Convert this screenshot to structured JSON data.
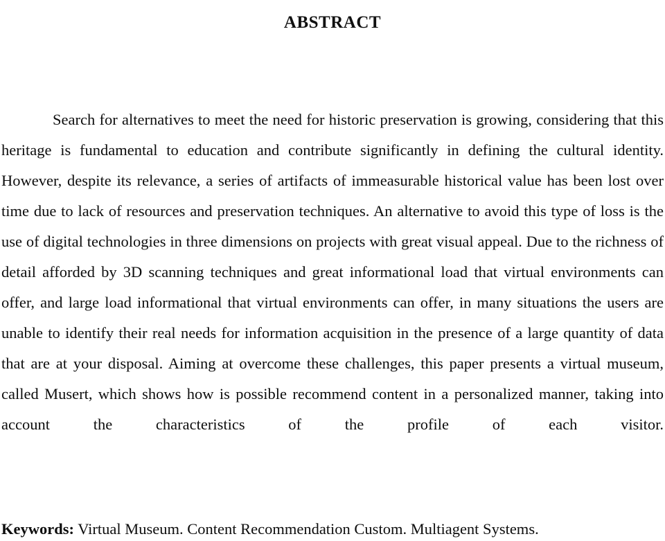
{
  "document": {
    "section_title": "ABSTRACT",
    "abstract_text": "Search for alternatives to meet the need for historic preservation is growing, considering that this heritage is fundamental to education and contribute significantly in defining the cultural identity. However, despite its relevance, a series of artifacts of immeasurable historical value has been lost over time due to lack of resources and preservation techniques. An alternative to avoid this type of loss is the use of digital technologies in three dimensions on projects with great visual appeal. Due to the richness of detail afforded by 3D scanning techniques and great informational load that virtual environments can offer, and large load  informational that virtual environments can offer, in many situations the users are unable to identify their real needs for information acquisition in the presence of a large quantity of data that are at your disposal. Aiming at overcome these challenges, this paper presents a virtual museum, called Musert, which shows how is possible recommend content in a personalized manner, taking into account the characteristics of the profile of each visitor.",
    "keywords": {
      "label": "Keywords:",
      "values": "Virtual Museum. Content Recommendation Custom. Multiagent Systems.",
      "list": [
        "Virtual Museum.",
        "Content Recommendation Custom.",
        "Multiagent Systems."
      ]
    },
    "colors": {
      "page_background": "#ffffff",
      "text": "#0d0d0d",
      "heading": "#111111"
    }
  }
}
